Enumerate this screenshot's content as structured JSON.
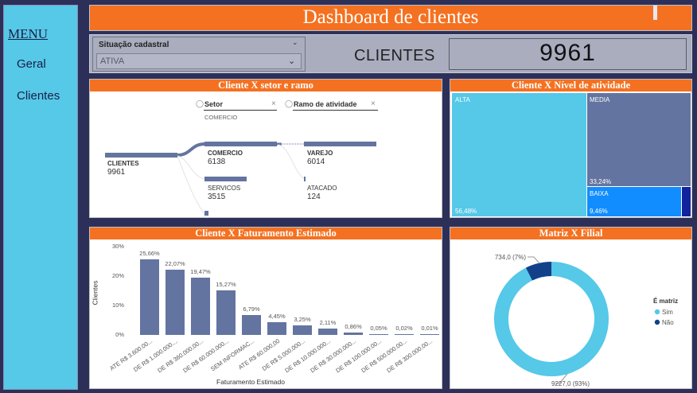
{
  "sidebar": {
    "menu_title": "MENU",
    "items": [
      {
        "label": "Geral"
      },
      {
        "label": "Clientes"
      }
    ]
  },
  "header": {
    "title": "Dashboard de clientes"
  },
  "filter": {
    "label": "Situação cadastral",
    "value": "ATIVA"
  },
  "kpi": {
    "label": "CLIENTES",
    "value": "9961"
  },
  "tree": {
    "title": "Cliente X setor e ramo",
    "levels": [
      {
        "label": "Setor",
        "selected": "COMERCIO"
      },
      {
        "label": "Ramo de atividade"
      }
    ],
    "root": {
      "name": "CLIENTES",
      "value": "9961"
    },
    "level1": [
      {
        "name": "COMERCIO",
        "value": "6138"
      },
      {
        "name": "SERVICOS",
        "value": "3515"
      }
    ],
    "level2": [
      {
        "name": "VAREJO",
        "value": "6014"
      },
      {
        "name": "ATACADO",
        "value": "124"
      }
    ]
  },
  "treemap": {
    "title": "Cliente X Nível de atividade",
    "blocks": [
      {
        "name": "ALTA",
        "pct": "56,48%",
        "color": "#56c8e8"
      },
      {
        "name": "MEDIA",
        "pct": "33,24%",
        "color": "#6474a0"
      },
      {
        "name": "BAIXA",
        "pct": "9,46%",
        "color": "#118dff"
      },
      {
        "name": "",
        "pct": "",
        "color": "#12239e"
      }
    ]
  },
  "bar_title": "Cliente X Faturamento Estimado",
  "donut_title": "Matriz X Filial",
  "chart_data": [
    {
      "type": "bar",
      "title": "Cliente X Faturamento Estimado",
      "xlabel": "Faturamento Estimado",
      "ylabel": "Clientes",
      "yticks": [
        "30%",
        "20%",
        "10%",
        "0%"
      ],
      "ylim": [
        0,
        30
      ],
      "color": "#6474a0",
      "categories": [
        "ATE R$ 3.600.00...",
        "DE R$ 1.000.000....",
        "DE R$ 360.000,00...",
        "DE R$ 60.000.000...",
        "SEM INFORMAC...",
        "ATE R$ 60.000,00",
        "DE R$ 5.000.000...",
        "DE R$ 10.000.000...",
        "DE R$ 30.000.000...",
        "DE R$ 100.000.00...",
        "DE R$ 500.000.00...",
        "DE R$ 300.000.00..."
      ],
      "values": [
        25.66,
        22.07,
        19.47,
        15.27,
        6.79,
        4.45,
        3.25,
        2.11,
        0.86,
        0.05,
        0.02,
        0.01
      ],
      "labels": [
        "25,66%",
        "22,07%",
        "19,47%",
        "15,27%",
        "6,79%",
        "4,45%",
        "3,25%",
        "2,11%",
        "0,86%",
        "0,05%",
        "0,02%",
        "0,01%"
      ]
    },
    {
      "type": "pie",
      "title": "Matriz X Filial",
      "legend_title": "É matriz",
      "legend_position": "right",
      "slices": [
        {
          "name": "Sim",
          "value": 9227.0,
          "label": "9227,0 (93%)",
          "color": "#56c8e8"
        },
        {
          "name": "Não",
          "value": 734.0,
          "label": "734,0 (7%)",
          "color": "#12418a"
        }
      ]
    }
  ]
}
